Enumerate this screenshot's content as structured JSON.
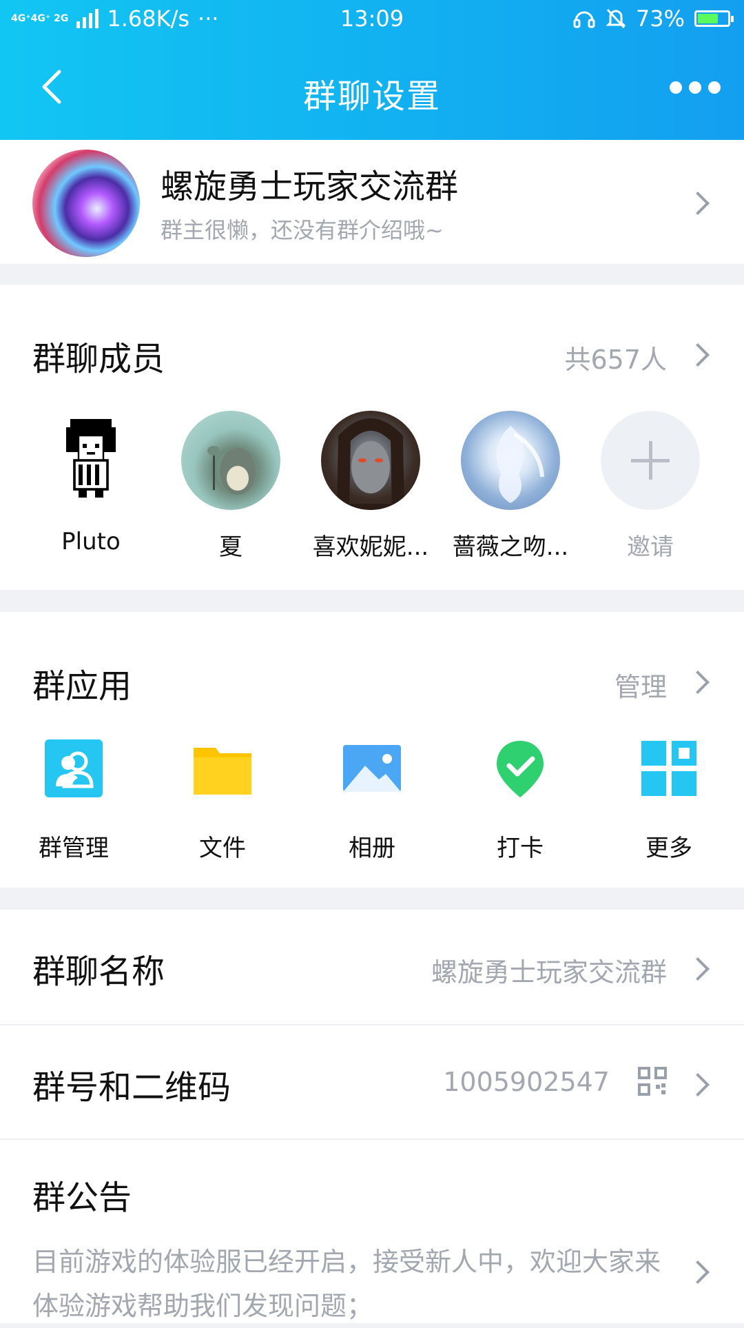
{
  "status_bar": {
    "network": "4G⁺4G⁺ 2G",
    "speed": "1.68K/s",
    "dots": "···",
    "time": "13:09",
    "battery": "73%",
    "battery_level": 0.73
  },
  "nav": {
    "title": "群聊设置",
    "back_icon": "back-icon",
    "more_icon": "more-icon"
  },
  "group": {
    "name": "螺旋勇士玩家交流群",
    "intro": "群主很懒，还没有群介绍哦~"
  },
  "members": {
    "title": "群聊成员",
    "count": "共657人",
    "items": [
      {
        "name": "Pluto"
      },
      {
        "name": "夏"
      },
      {
        "name": "喜欢妮妮..."
      },
      {
        "name": "蔷薇之吻..."
      },
      {
        "name": "邀请"
      }
    ]
  },
  "apps": {
    "title": "群应用",
    "manage": "管理",
    "items": [
      {
        "label": "群管理",
        "icon": "group-manage-icon"
      },
      {
        "label": "文件",
        "icon": "folder-icon"
      },
      {
        "label": "相册",
        "icon": "photo-album-icon"
      },
      {
        "label": "打卡",
        "icon": "check-in-icon"
      },
      {
        "label": "更多",
        "icon": "more-apps-icon"
      }
    ]
  },
  "settings": {
    "name_label": "群聊名称",
    "name_value": "螺旋勇士玩家交流群",
    "id_label": "群号和二维码",
    "id_value": "1005902547"
  },
  "notice": {
    "title": "群公告",
    "text": "目前游戏的体验服已经开启，接受新人中，欢迎大家来体验游戏帮助我们发现问题；"
  },
  "colors": {
    "header_gradient_start": "#12c6f3",
    "header_gradient_end": "#139ff0",
    "muted_text": "#a2a7b0",
    "check_green": "#2ed06f",
    "folder_yellow": "#ffc400",
    "app_cyan": "#26c6f2"
  }
}
